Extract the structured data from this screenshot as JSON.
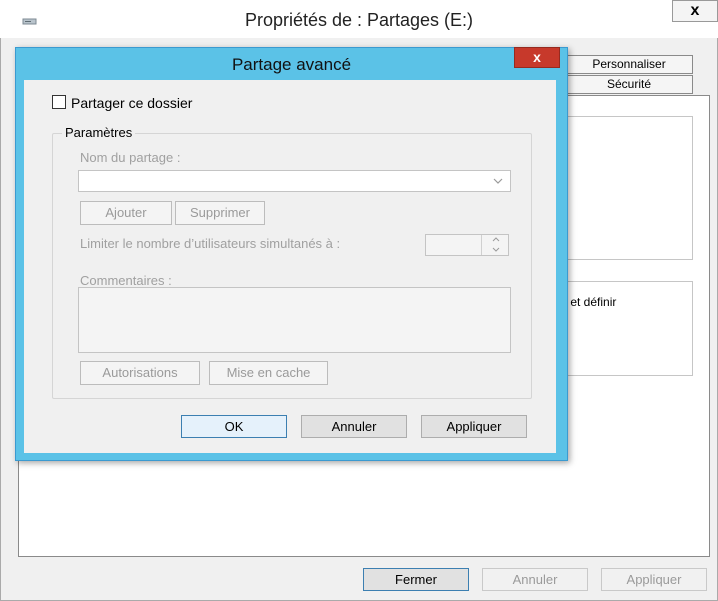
{
  "outer_window": {
    "title": "Propriétés de : Partages (E:)",
    "close_glyph": "x",
    "app_icon": "drive-icon",
    "tabs": [
      {
        "label": "Personnaliser"
      },
      {
        "label": "Sécurité"
      }
    ],
    "clipped_text": "s et définir",
    "buttons": {
      "close": "Fermer",
      "cancel": "Annuler",
      "apply": "Appliquer"
    }
  },
  "dialog": {
    "title": "Partage avancé",
    "close_glyph": "x",
    "share_checkbox": {
      "label": "Partager ce dossier",
      "checked": false
    },
    "settings": {
      "legend": "Paramètres",
      "share_name_label": "Nom du partage :",
      "share_name_value": "",
      "add_button": "Ajouter",
      "remove_button": "Supprimer",
      "limit_label": "Limiter le nombre d’utilisateurs simultanés à :",
      "limit_value": "",
      "comments_label": "Commentaires :",
      "comments_value": "",
      "permissions_button": "Autorisations",
      "caching_button": "Mise en cache"
    },
    "buttons": {
      "ok": "OK",
      "cancel": "Annuler",
      "apply": "Appliquer"
    }
  },
  "colors": {
    "dialog_frame": "#5bc2e7",
    "close_button": "#c7392b",
    "disabled_text": "#a0a0a0"
  }
}
